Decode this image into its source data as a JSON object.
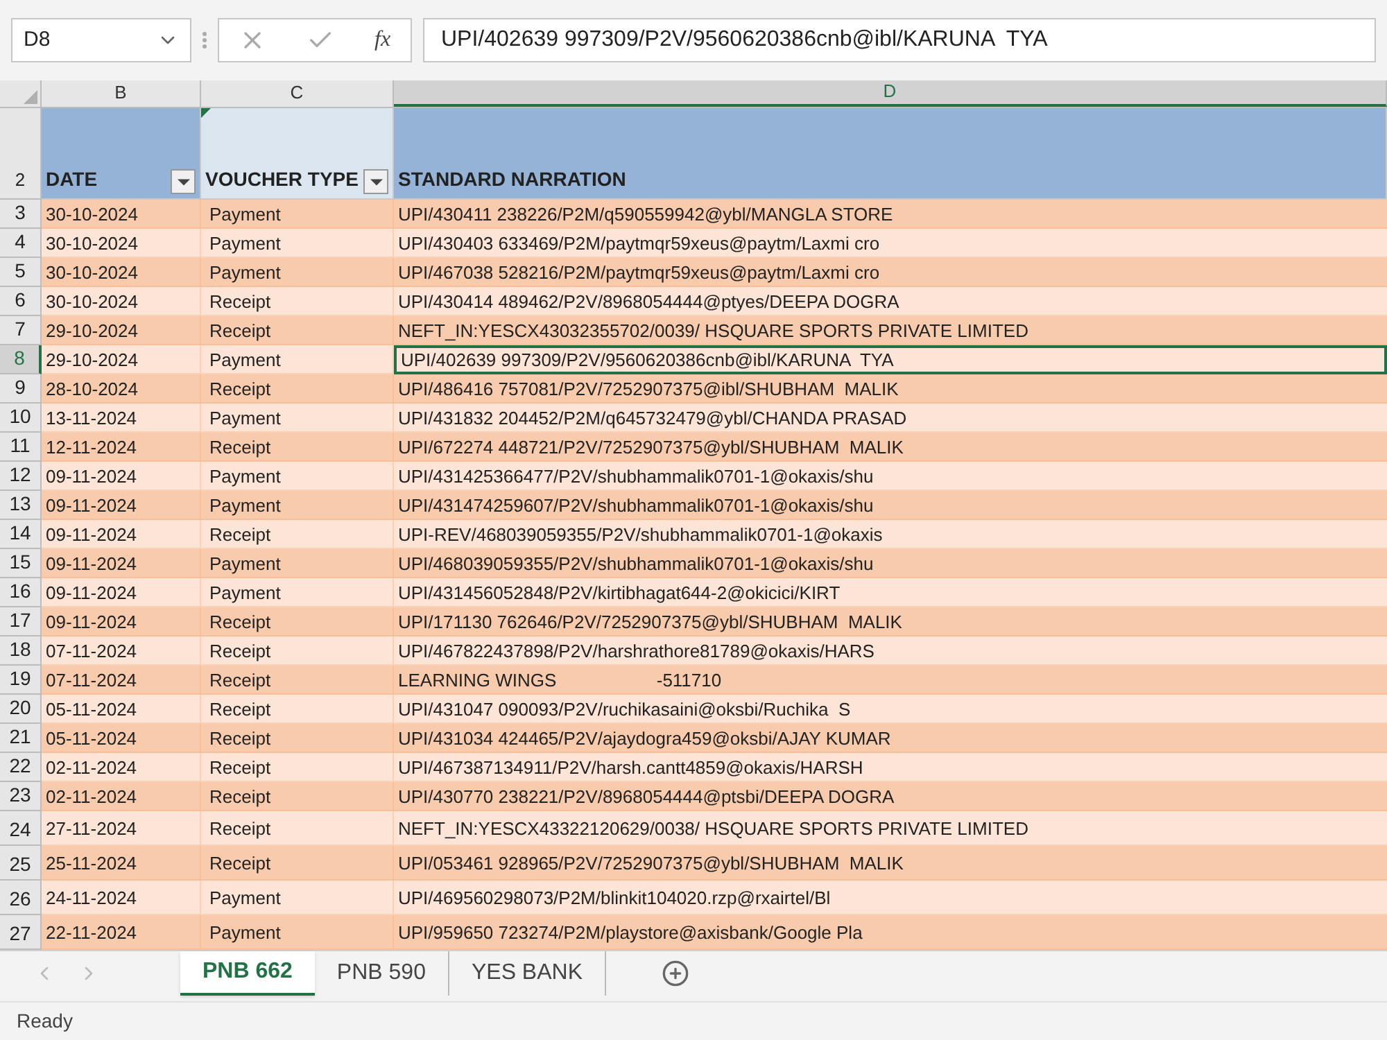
{
  "name_box": "D8",
  "function_label": "fx",
  "formula": "UPI/402639 997309/P2V/9560620386cnb@ibl/KARUNA  TYA",
  "columns": [
    {
      "label": "B",
      "selected": false
    },
    {
      "label": "C",
      "selected": false
    },
    {
      "label": "D",
      "selected": true
    }
  ],
  "header_row": {
    "number": "2",
    "cells": [
      {
        "text": "DATE",
        "filter": true
      },
      {
        "text": "VOUCHER TYPE",
        "filter": true
      },
      {
        "text": "STANDARD NARRATION",
        "filter": false
      }
    ]
  },
  "rows": [
    {
      "number": "3",
      "date": "30-10-2024",
      "voucher_type": "Payment",
      "narration": "UPI/430411 238226/P2M/q590559942@ybl/MANGLA STORE",
      "selected": false
    },
    {
      "number": "4",
      "date": "30-10-2024",
      "voucher_type": "Payment",
      "narration": "UPI/430403 633469/P2M/paytmqr59xeus@paytm/Laxmi cro",
      "selected": false
    },
    {
      "number": "5",
      "date": "30-10-2024",
      "voucher_type": "Payment",
      "narration": "UPI/467038 528216/P2M/paytmqr59xeus@paytm/Laxmi cro",
      "selected": false
    },
    {
      "number": "6",
      "date": "30-10-2024",
      "voucher_type": "Receipt",
      "narration": "UPI/430414 489462/P2V/8968054444@ptyes/DEEPA DOGRA",
      "selected": false
    },
    {
      "number": "7",
      "date": "29-10-2024",
      "voucher_type": "Receipt",
      "narration": "NEFT_IN:YESCX43032355702/0039/ HSQUARE SPORTS PRIVATE LIMITED",
      "selected": false
    },
    {
      "number": "8",
      "date": "29-10-2024",
      "voucher_type": "Payment",
      "narration": "UPI/402639 997309/P2V/9560620386cnb@ibl/KARUNA  TYA",
      "selected": true
    },
    {
      "number": "9",
      "date": "28-10-2024",
      "voucher_type": "Receipt",
      "narration": "UPI/486416 757081/P2V/7252907375@ibl/SHUBHAM  MALIK",
      "selected": false
    },
    {
      "number": "10",
      "date": "13-11-2024",
      "voucher_type": "Payment",
      "narration": "UPI/431832 204452/P2M/q645732479@ybl/CHANDA PRASAD",
      "selected": false
    },
    {
      "number": "11",
      "date": "12-11-2024",
      "voucher_type": "Receipt",
      "narration": "UPI/672274 448721/P2V/7252907375@ybl/SHUBHAM  MALIK",
      "selected": false
    },
    {
      "number": "12",
      "date": "09-11-2024",
      "voucher_type": "Payment",
      "narration": "UPI/431425366477/P2V/shubhammalik0701-1@okaxis/shu",
      "selected": false
    },
    {
      "number": "13",
      "date": "09-11-2024",
      "voucher_type": "Payment",
      "narration": "UPI/431474259607/P2V/shubhammalik0701-1@okaxis/shu",
      "selected": false
    },
    {
      "number": "14",
      "date": "09-11-2024",
      "voucher_type": "Receipt",
      "narration": "UPI-REV/468039059355/P2V/shubhammalik0701-1@okaxis",
      "selected": false
    },
    {
      "number": "15",
      "date": "09-11-2024",
      "voucher_type": "Payment",
      "narration": "UPI/468039059355/P2V/shubhammalik0701-1@okaxis/shu",
      "selected": false
    },
    {
      "number": "16",
      "date": "09-11-2024",
      "voucher_type": "Payment",
      "narration": "UPI/431456052848/P2V/kirtibhagat644-2@okicici/KIRT",
      "selected": false
    },
    {
      "number": "17",
      "date": "09-11-2024",
      "voucher_type": "Receipt",
      "narration": "UPI/171130 762646/P2V/7252907375@ybl/SHUBHAM  MALIK",
      "selected": false
    },
    {
      "number": "18",
      "date": "07-11-2024",
      "voucher_type": "Receipt",
      "narration": "UPI/467822437898/P2V/harshrathore81789@okaxis/HARS",
      "selected": false
    },
    {
      "number": "19",
      "date": "07-11-2024",
      "voucher_type": "Receipt",
      "narration": "LEARNING WINGS                    -511710",
      "selected": false
    },
    {
      "number": "20",
      "date": "05-11-2024",
      "voucher_type": "Receipt",
      "narration": "UPI/431047 090093/P2V/ruchikasaini@oksbi/Ruchika  S",
      "selected": false
    },
    {
      "number": "21",
      "date": "05-11-2024",
      "voucher_type": "Receipt",
      "narration": "UPI/431034 424465/P2V/ajaydogra459@oksbi/AJAY KUMAR",
      "selected": false
    },
    {
      "number": "22",
      "date": "02-11-2024",
      "voucher_type": "Receipt",
      "narration": "UPI/467387134911/P2V/harsh.cantt4859@okaxis/HARSH",
      "selected": false
    },
    {
      "number": "23",
      "date": "02-11-2024",
      "voucher_type": "Receipt",
      "narration": "UPI/430770 238221/P2V/8968054444@ptsbi/DEEPA DOGRA",
      "selected": false
    },
    {
      "number": "24",
      "date": "27-11-2024",
      "voucher_type": "Receipt",
      "narration": "NEFT_IN:YESCX43322120629/0038/ HSQUARE SPORTS PRIVATE LIMITED",
      "selected": false
    },
    {
      "number": "25",
      "date": "25-11-2024",
      "voucher_type": "Receipt",
      "narration": "UPI/053461 928965/P2V/7252907375@ybl/SHUBHAM  MALIK",
      "selected": false
    },
    {
      "number": "26",
      "date": "24-11-2024",
      "voucher_type": "Payment",
      "narration": "UPI/469560298073/P2M/blinkit104020.rzp@rxairtel/Bl",
      "selected": false
    },
    {
      "number": "27",
      "date": "22-11-2024",
      "voucher_type": "Payment",
      "narration": "UPI/959650 723274/P2M/playstore@axisbank/Google Pla",
      "selected": false
    }
  ],
  "sheet_tabs": [
    {
      "label": "PNB 662",
      "selected": true
    },
    {
      "label": "PNB 590",
      "selected": false
    },
    {
      "label": "YES BANK",
      "selected": false
    }
  ],
  "status_bar": "Ready"
}
